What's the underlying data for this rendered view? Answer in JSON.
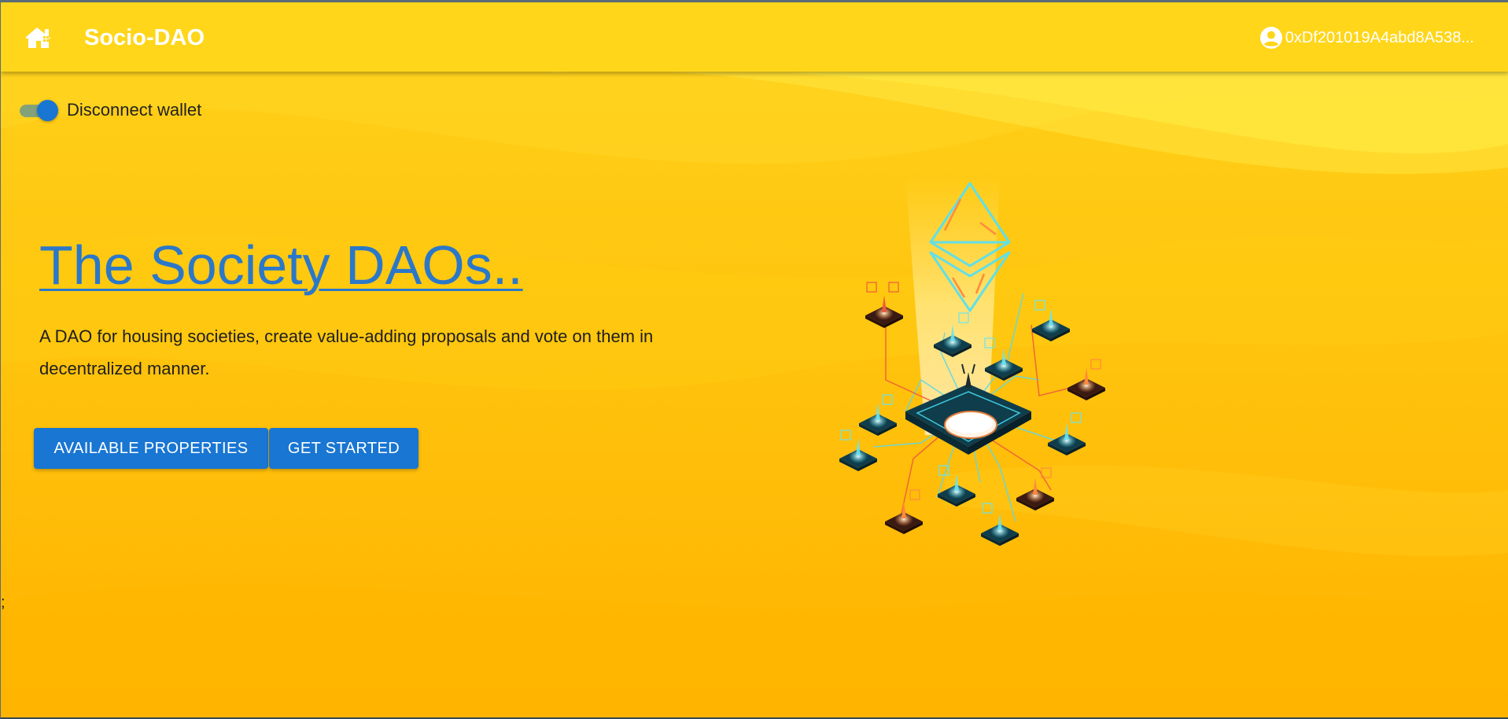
{
  "header": {
    "brand": "Socio-DAO",
    "account_address": "0xDf201019A4abd8A538...",
    "home_icon": "home-icon",
    "account_icon": "account-circle-icon"
  },
  "wallet_toggle": {
    "label": "Disconnect wallet",
    "checked": true
  },
  "hero": {
    "title": "The Society DAOs..",
    "description": "A DAO for housing societies, create value-adding proposals and vote on them in decentralized manner.",
    "buttons": {
      "available_properties": "AVAILABLE PROPERTIES",
      "get_started": "GET STARTED"
    }
  },
  "stray_text": ";",
  "colors": {
    "background": "#ffc107",
    "header": "#ffd61a",
    "primary": "#1976d2",
    "title_link": "#2b78c9"
  }
}
